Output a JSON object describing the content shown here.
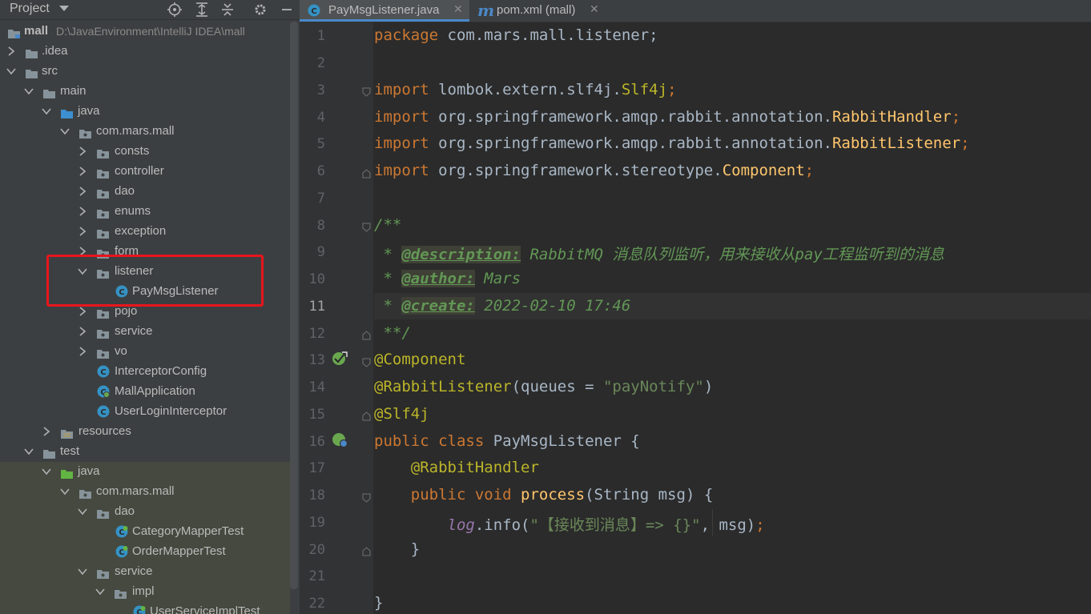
{
  "project_panel": {
    "title": "Project",
    "icons": [
      "locate-icon",
      "expand-all-icon",
      "collapse-all-icon",
      "settings-icon",
      "hide-icon"
    ],
    "tree": [
      {
        "label": "mall",
        "path": "D:\\JavaEnvironment\\IntelliJ IDEA\\mall",
        "type": "module"
      },
      {
        "label": ".idea",
        "type": "folder"
      },
      {
        "label": "src",
        "type": "folder"
      },
      {
        "label": "main",
        "type": "folder"
      },
      {
        "label": "java",
        "type": "source-root"
      },
      {
        "label": "com.mars.mall",
        "type": "package"
      },
      {
        "label": "consts",
        "type": "package"
      },
      {
        "label": "controller",
        "type": "package"
      },
      {
        "label": "dao",
        "type": "package"
      },
      {
        "label": "enums",
        "type": "package"
      },
      {
        "label": "exception",
        "type": "package"
      },
      {
        "label": "form",
        "type": "package"
      },
      {
        "label": "listener",
        "type": "package"
      },
      {
        "label": "PayMsgListener",
        "type": "class"
      },
      {
        "label": "pojo",
        "type": "package"
      },
      {
        "label": "service",
        "type": "package"
      },
      {
        "label": "vo",
        "type": "package"
      },
      {
        "label": "InterceptorConfig",
        "type": "class"
      },
      {
        "label": "MallApplication",
        "type": "class"
      },
      {
        "label": "UserLoginInterceptor",
        "type": "class"
      },
      {
        "label": "resources",
        "type": "resources-root"
      },
      {
        "label": "test",
        "type": "folder"
      },
      {
        "label": "java",
        "type": "test-root"
      },
      {
        "label": "com.mars.mall",
        "type": "package"
      },
      {
        "label": "dao",
        "type": "package"
      },
      {
        "label": "CategoryMapperTest",
        "type": "test-class"
      },
      {
        "label": "OrderMapperTest",
        "type": "test-class"
      },
      {
        "label": "service",
        "type": "package"
      },
      {
        "label": "impl",
        "type": "package"
      },
      {
        "label": "UserServiceImplTest",
        "type": "test-class"
      }
    ]
  },
  "tabs": [
    {
      "label": "PayMsgListener.java",
      "active": true
    },
    {
      "label": "pom.xml (mall)",
      "active": false
    }
  ],
  "editor": {
    "current_line": 11,
    "line_numbers": [
      "1",
      "2",
      "3",
      "4",
      "5",
      "6",
      "7",
      "8",
      "9",
      "10",
      "11",
      "12",
      "13",
      "14",
      "15",
      "16",
      "17",
      "18",
      "19",
      "20",
      "21",
      "22"
    ],
    "code": {
      "l1": {
        "kw": "package",
        "rest": " com.mars.mall.listener;"
      },
      "l3": {
        "kw": "import",
        "pkg": " lombok.extern.slf4j.",
        "cls": "Slf4j",
        "end": ";"
      },
      "l4": {
        "kw": "import",
        "pkg": " org.springframework.amqp.rabbit.annotation.",
        "cls": "RabbitHandler",
        "end": ";"
      },
      "l5": {
        "kw": "import",
        "pkg": " org.springframework.amqp.rabbit.annotation.",
        "cls": "RabbitListener",
        "end": ";"
      },
      "l6": {
        "kw": "import",
        "pkg": " org.springframework.stereotype.",
        "cls": "Component",
        "end": ";"
      },
      "l8": "/**",
      "l9": {
        "star": " * ",
        "tag": "@description:",
        "text": " RabbitMQ 消息队列监听，用来接收从pay工程监听到的消息"
      },
      "l10": {
        "star": " * ",
        "tag": "@author:",
        "text": " Mars"
      },
      "l11": {
        "star": " * ",
        "tag": "@create:",
        "text": " 2022-02-10 17:46"
      },
      "l12": " **/",
      "l13": "@Component",
      "l14": {
        "ann": "@RabbitListener",
        "open": "(queues = ",
        "str": "\"payNotify\"",
        "close": ")"
      },
      "l15": "@Slf4j",
      "l16": {
        "kw": "public class",
        "rest": " PayMsgListener {"
      },
      "l17": "    @RabbitHandler",
      "l18": {
        "kw": "    public void",
        "fn": " process",
        "rest": "(String msg) {"
      },
      "l19": {
        "indent": "        ",
        "log": "log",
        "dot": ".info(",
        "str": "\"【接收到消息】=> {}\"",
        "rest": ", msg)",
        "semi": ";"
      },
      "l20": "    }",
      "l22": "}"
    }
  },
  "colors": {
    "highlight_box": "#e8151d",
    "keyword": "#cc7832",
    "annotation": "#bbb529",
    "string": "#6a8759",
    "doc_comment": "#629755",
    "method": "#ffc66d"
  }
}
